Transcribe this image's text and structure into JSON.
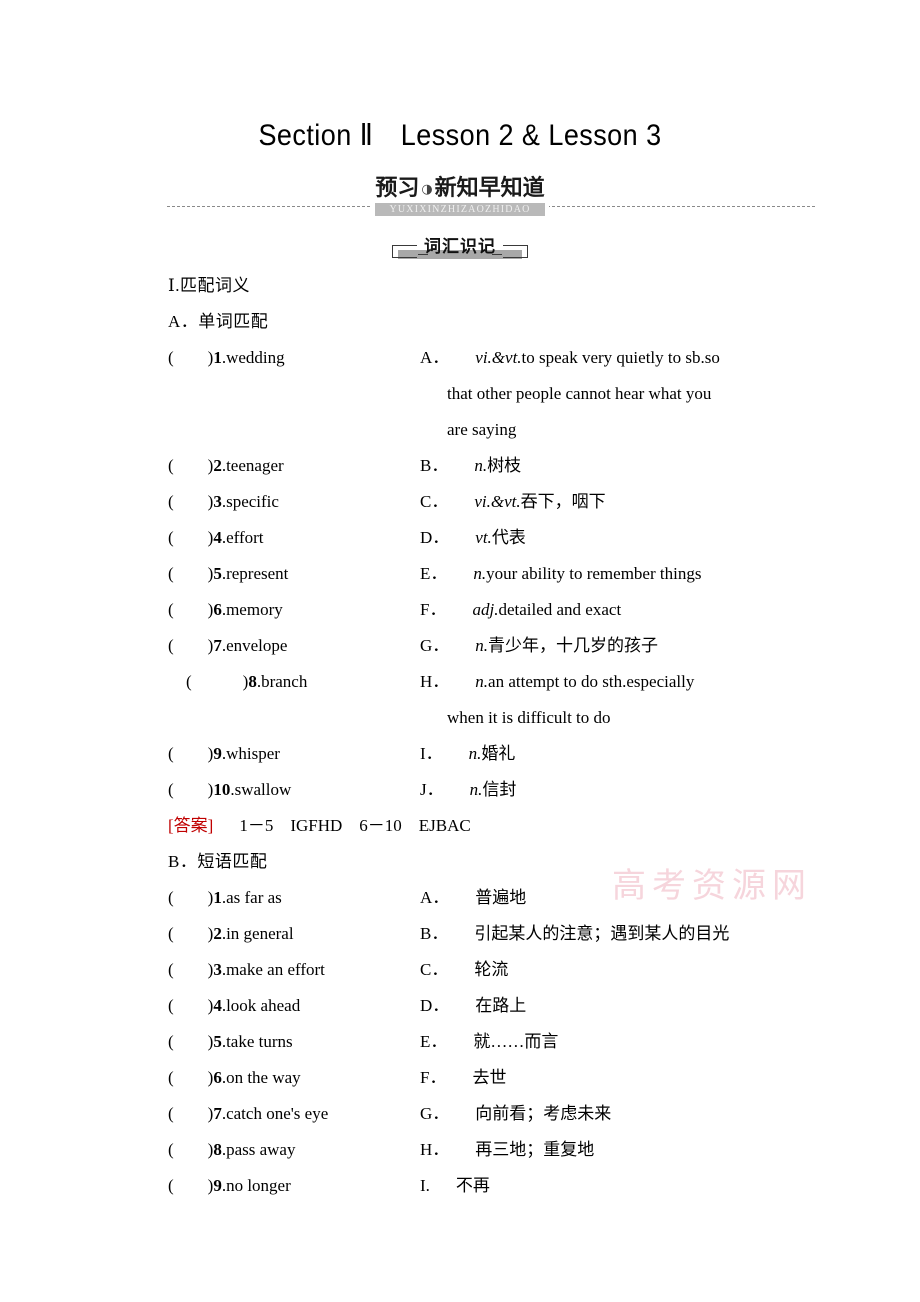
{
  "page": {
    "title": "Section Ⅱ　Lesson 2 & Lesson 3",
    "watermark": "高考资源网"
  },
  "banner": {
    "label_main": "预习",
    "separator": "◑",
    "label_sub": "新知早知道",
    "pinyin": "YUXIXINZHIZAOZHIDAO"
  },
  "subbanner": {
    "label": "词汇识记"
  },
  "section_i": {
    "heading": "Ⅰ.匹配词义",
    "part_a": {
      "heading": "A．单词匹配",
      "words": [
        {
          "mark": "(　　)",
          "num": "1",
          "text": ".wedding"
        },
        {
          "mark": "(　　)",
          "num": "2",
          "text": ".teenager"
        },
        {
          "mark": "(　　)",
          "num": "3",
          "text": ".specific"
        },
        {
          "mark": "(　　)",
          "num": "4",
          "text": ".effort"
        },
        {
          "mark": "(　　)",
          "num": "5",
          "text": ".represent"
        },
        {
          "mark": "(　　)",
          "num": "6",
          "text": ".memory"
        },
        {
          "mark": "(　　)",
          "num": "7",
          "text": ".envelope"
        },
        {
          "mark": "(　　　)",
          "num": "8",
          "text": ".branch"
        },
        {
          "mark": "(　　)",
          "num": "9",
          "text": ".whisper"
        },
        {
          "mark": "(　　)",
          "num": "10",
          "text": ".swallow"
        }
      ],
      "definitions": [
        {
          "letter": "A．",
          "pos": "vi.&vt.",
          "text": "to speak very quietly to sb.so"
        },
        {
          "cont": "that other people cannot hear what you"
        },
        {
          "cont": "are saying"
        },
        {
          "letter": "B．",
          "pos": "n.",
          "text": "树枝"
        },
        {
          "letter": "C．",
          "pos": "vi.&vt.",
          "text": "吞下，咽下"
        },
        {
          "letter": "D．",
          "pos": "vt.",
          "text": "代表"
        },
        {
          "letter": "E．",
          "pos": "n.",
          "text": "your ability to remember things"
        },
        {
          "letter": "F．",
          "pos": "adj.",
          "text": "detailed and exact"
        },
        {
          "letter": "G．",
          "pos": "n.",
          "text": "青少年，十几岁的孩子"
        },
        {
          "letter": "H．",
          "pos": "n.",
          "text": "an attempt to do sth.especially"
        },
        {
          "cont": "when it is difficult to do"
        },
        {
          "letter": "I．",
          "pos": "n.",
          "text": "婚礼"
        },
        {
          "letter": "J．",
          "pos": "n.",
          "text": "信封"
        }
      ],
      "answer": {
        "tag": "[答案]",
        "text": "1－5　IGFHD　6－10　EJBAC"
      }
    },
    "part_b": {
      "heading": "B．短语匹配",
      "phrases": [
        {
          "mark": "(　　)",
          "num": "1",
          "text": ".as far as"
        },
        {
          "mark": "(　　)",
          "num": "2",
          "text": ".in general"
        },
        {
          "mark": "(　　)",
          "num": "3",
          "text": ".make an effort"
        },
        {
          "mark": "(　　)",
          "num": "4",
          "text": ".look ahead"
        },
        {
          "mark": "(　　)",
          "num": "5",
          "text": ".take turns"
        },
        {
          "mark": "(　　)",
          "num": "6",
          "text": ".on the way"
        },
        {
          "mark": "(　　)",
          "num": "7",
          "text": ".catch one's eye"
        },
        {
          "mark": "(　　)",
          "num": "8",
          "text": ".pass away"
        },
        {
          "mark": "(　　)",
          "num": "9",
          "text": ".no longer"
        }
      ],
      "meanings": [
        {
          "letter": "A．",
          "text": "普遍地"
        },
        {
          "letter": "B．",
          "text": "引起某人的注意；遇到某人的目光"
        },
        {
          "letter": "C．",
          "text": "轮流"
        },
        {
          "letter": "D．",
          "text": "在路上"
        },
        {
          "letter": "E．",
          "text": "就……而言"
        },
        {
          "letter": "F．",
          "text": "去世"
        },
        {
          "letter": "G．",
          "text": "向前看；考虑未来"
        },
        {
          "letter": "H．",
          "text": "再三地；重复地"
        },
        {
          "letter": "I.",
          "text": "不再"
        }
      ]
    }
  }
}
